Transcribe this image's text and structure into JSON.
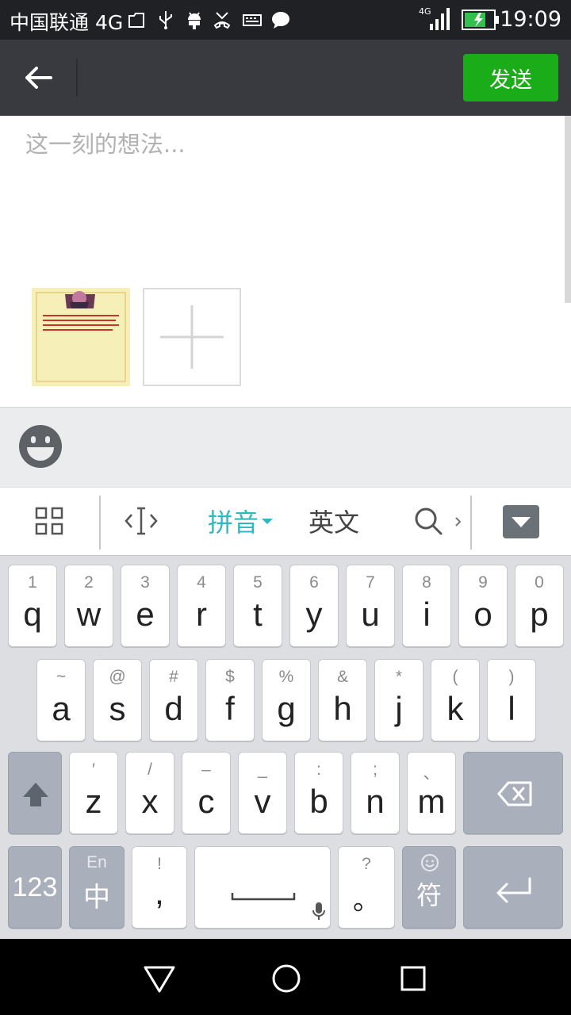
{
  "status_bar": {
    "carrier": "中国联通 4G",
    "signal_tag": "4G",
    "time": "19:09",
    "icons": [
      "file-icon",
      "usb-icon",
      "android-icon",
      "missed-call-icon",
      "keyboard-icon",
      "chat-bubble-icon"
    ]
  },
  "title_bar": {
    "send_label": "发送",
    "accent_color": "#1aad19"
  },
  "compose": {
    "placeholder": "这一刻的想法..."
  },
  "ime_toolbar": {
    "pinyin_label": "拼音",
    "english_label": "英文",
    "active_color": "#2eb8c1"
  },
  "keyboard": {
    "row1": [
      {
        "sub": "1",
        "main": "q"
      },
      {
        "sub": "2",
        "main": "w"
      },
      {
        "sub": "3",
        "main": "e"
      },
      {
        "sub": "4",
        "main": "r"
      },
      {
        "sub": "5",
        "main": "t"
      },
      {
        "sub": "6",
        "main": "y"
      },
      {
        "sub": "7",
        "main": "u"
      },
      {
        "sub": "8",
        "main": "i"
      },
      {
        "sub": "9",
        "main": "o"
      },
      {
        "sub": "0",
        "main": "p"
      }
    ],
    "row2": [
      {
        "sub": "~",
        "main": "a"
      },
      {
        "sub": "@",
        "main": "s"
      },
      {
        "sub": "#",
        "main": "d"
      },
      {
        "sub": "$",
        "main": "f"
      },
      {
        "sub": "%",
        "main": "g"
      },
      {
        "sub": "&",
        "main": "h"
      },
      {
        "sub": "*",
        "main": "j"
      },
      {
        "sub": "(",
        "main": "k"
      },
      {
        "sub": ")",
        "main": "l"
      }
    ],
    "row3": [
      {
        "sub": "′",
        "main": "z"
      },
      {
        "sub": "/",
        "main": "x"
      },
      {
        "sub": "–",
        "main": "c"
      },
      {
        "sub": "_",
        "main": "v"
      },
      {
        "sub": ":",
        "main": "b"
      },
      {
        "sub": ";",
        "main": "n"
      },
      {
        "sub": "、",
        "main": "m"
      }
    ],
    "num_label": "123",
    "lang_sub": "En",
    "lang_main": "中",
    "comma_sub": "!",
    "comma_main": ",",
    "period_sub": "?",
    "period_main": "。",
    "symbol_label": "符"
  }
}
